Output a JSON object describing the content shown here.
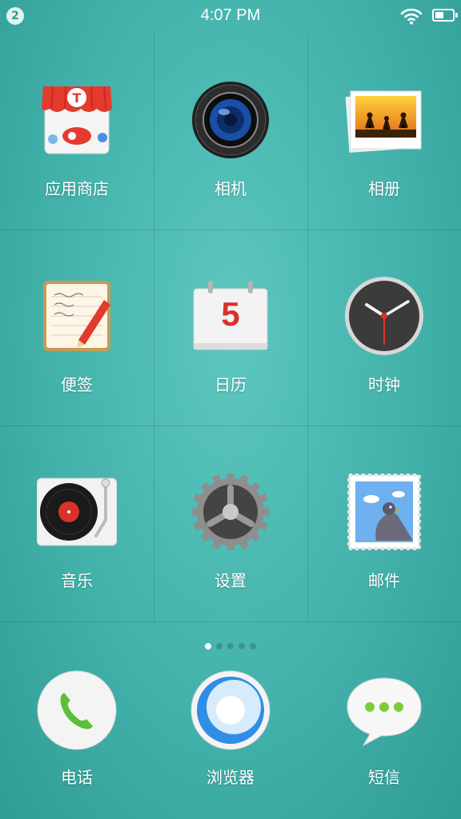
{
  "status_bar": {
    "notification_count": "2",
    "time": "4:07 PM"
  },
  "apps": [
    {
      "label": "应用商店",
      "icon": "store-icon"
    },
    {
      "label": "相机",
      "icon": "camera-icon"
    },
    {
      "label": "相册",
      "icon": "gallery-icon"
    },
    {
      "label": "便签",
      "icon": "notes-icon"
    },
    {
      "label": "日历",
      "icon": "calendar-icon",
      "day": "5"
    },
    {
      "label": "时钟",
      "icon": "clock-icon"
    },
    {
      "label": "音乐",
      "icon": "music-icon"
    },
    {
      "label": "设置",
      "icon": "settings-icon"
    },
    {
      "label": "邮件",
      "icon": "mail-icon"
    }
  ],
  "page_indicator": {
    "pages": 5,
    "current": 1
  },
  "dock": [
    {
      "label": "电话",
      "icon": "phone-icon"
    },
    {
      "label": "浏览器",
      "icon": "browser-icon"
    },
    {
      "label": "短信",
      "icon": "sms-icon"
    }
  ],
  "colors": {
    "background": "#43b2ab",
    "camera_lens": "#1a4fa8",
    "calendar_red": "#d9322b",
    "phone_green": "#5bbf3a",
    "sms_green": "#7ccc3a"
  }
}
